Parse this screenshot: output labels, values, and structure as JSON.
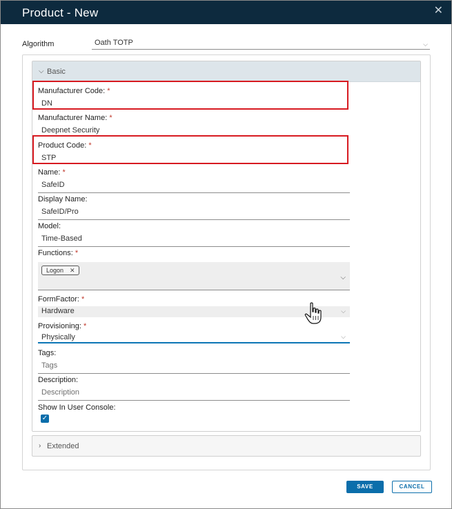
{
  "dialog": {
    "title": "Product - New",
    "close_glyph": "✕"
  },
  "algorithm": {
    "label": "Algorithm",
    "value": "Oath TOTP"
  },
  "sections": {
    "basic": {
      "label": "Basic"
    },
    "extended": {
      "label": "Extended"
    }
  },
  "fields": {
    "manufacturer_code": {
      "label": "Manufacturer Code:",
      "required": "*",
      "value": "DN"
    },
    "manufacturer_name": {
      "label": "Manufacturer Name:",
      "required": "*",
      "value": "Deepnet Security"
    },
    "product_code": {
      "label": "Product Code:",
      "required": "*",
      "value": "STP"
    },
    "name": {
      "label": "Name:",
      "required": "*",
      "value": "SafeID"
    },
    "display_name": {
      "label": "Display Name:",
      "value": "SafeID/Pro"
    },
    "model": {
      "label": "Model:",
      "value": "Time-Based"
    },
    "functions": {
      "label": "Functions:",
      "required": "*",
      "chips": [
        "Logon"
      ]
    },
    "form_factor": {
      "label": "FormFactor:",
      "required": "*",
      "value": "Hardware"
    },
    "provisioning": {
      "label": "Provisioning:",
      "required": "*",
      "value": "Physically"
    },
    "tags": {
      "label": "Tags:",
      "placeholder": "Tags"
    },
    "description": {
      "label": "Description:",
      "placeholder": "Description"
    },
    "show_in_user_console": {
      "label": "Show In User Console:",
      "checked": true
    }
  },
  "buttons": {
    "save": "SAVE",
    "cancel": "CANCEL"
  },
  "colors": {
    "title_bar": "#0d2a3e",
    "accent": "#0b6eab",
    "highlight": "#d71920",
    "required": "#c0392b"
  }
}
